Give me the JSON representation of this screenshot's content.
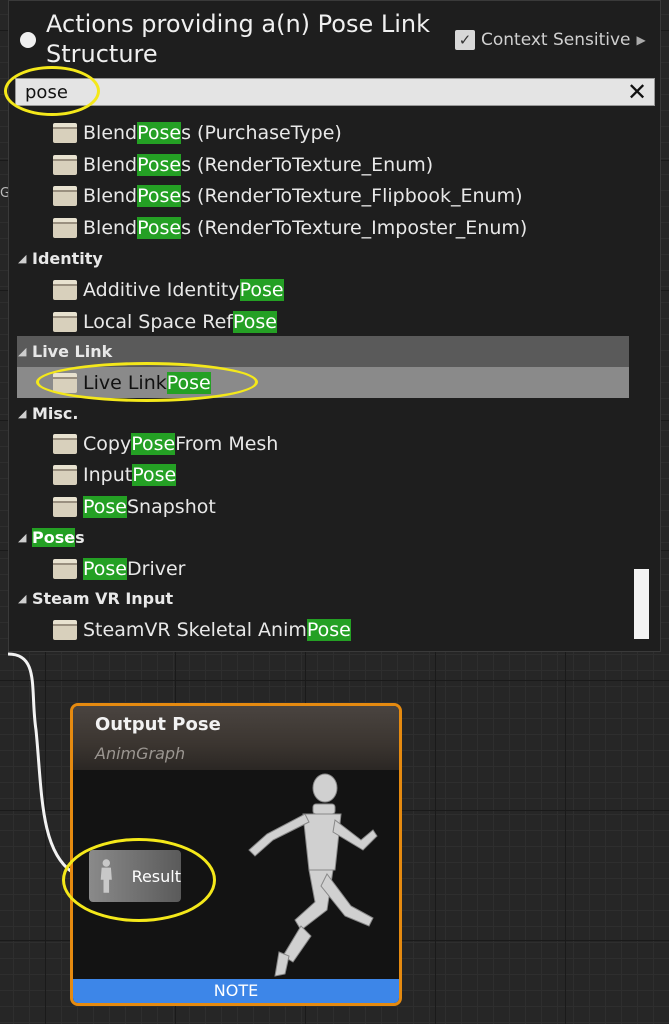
{
  "menu": {
    "title": "Actions providing a(n) Pose Link Structure",
    "context_sensitive_label": "Context Sensitive",
    "context_sensitive_checked": true,
    "search_value": "pose",
    "rows": [
      {
        "kind": "item",
        "pre": "Blend ",
        "hl": "Pose",
        "post": "s (PurchaseType)"
      },
      {
        "kind": "item",
        "pre": "Blend ",
        "hl": "Pose",
        "post": "s (RenderToTexture_Enum)"
      },
      {
        "kind": "item",
        "pre": "Blend ",
        "hl": "Pose",
        "post": "s (RenderToTexture_Flipbook_Enum)"
      },
      {
        "kind": "item",
        "pre": "Blend ",
        "hl": "Pose",
        "post": "s (RenderToTexture_Imposter_Enum)"
      },
      {
        "kind": "cat",
        "pre": "Identity",
        "hl": "",
        "post": ""
      },
      {
        "kind": "item",
        "pre": "Additive Identity ",
        "hl": "Pose",
        "post": ""
      },
      {
        "kind": "item",
        "pre": "Local Space Ref ",
        "hl": "Pose",
        "post": ""
      },
      {
        "kind": "cat",
        "pre": "Live Link",
        "hl": "",
        "post": "",
        "selected": true
      },
      {
        "kind": "item",
        "pre": "Live Link ",
        "hl": "Pose",
        "post": "",
        "selected": true
      },
      {
        "kind": "cat",
        "pre": "Misc.",
        "hl": "",
        "post": ""
      },
      {
        "kind": "item",
        "pre": "Copy ",
        "hl": "Pose",
        "post": " From Mesh"
      },
      {
        "kind": "item",
        "pre": "Input ",
        "hl": "Pose",
        "post": ""
      },
      {
        "kind": "item",
        "pre": "",
        "hl": "Pose",
        "post": " Snapshot"
      },
      {
        "kind": "cat",
        "pre": "",
        "hl": "Pose",
        "post": "s"
      },
      {
        "kind": "item",
        "pre": "",
        "hl": "Pose",
        "post": " Driver"
      },
      {
        "kind": "cat",
        "pre": "Steam VR Input",
        "hl": "",
        "post": ""
      },
      {
        "kind": "item",
        "pre": "SteamVR Skeletal Anim ",
        "hl": "Pose",
        "post": ""
      }
    ]
  },
  "node": {
    "title": "Output Pose",
    "subtitle": "AnimGraph",
    "pin_label": "Result",
    "footer": "NOTE"
  },
  "colors": {
    "highlight": "#24a024",
    "node_border": "#e58a10",
    "annotation": "#f4e81a",
    "note_bar": "#3d86e8"
  }
}
